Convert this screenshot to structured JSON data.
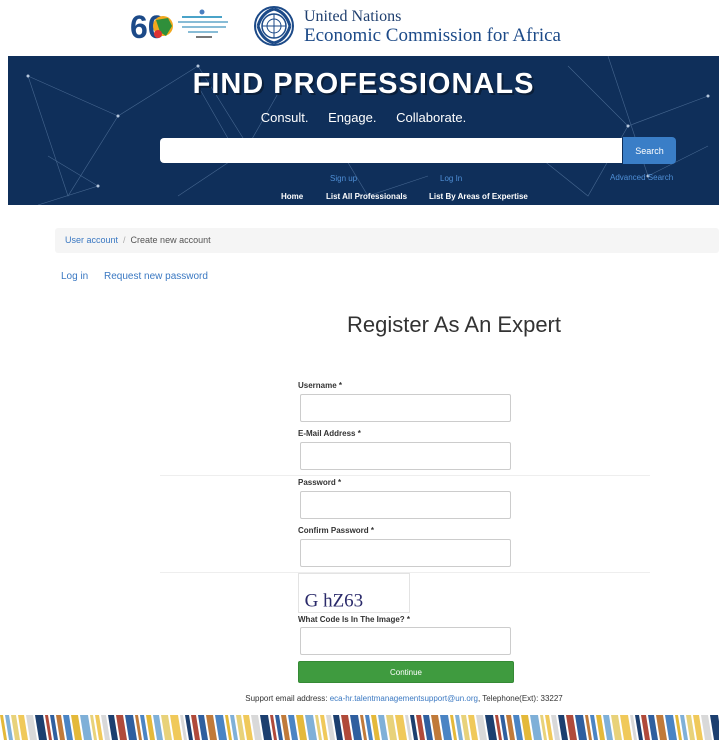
{
  "header": {
    "org_line1": "United Nations",
    "org_line2": "Economic Commission for Africa",
    "anniversary_mark": "60"
  },
  "hero": {
    "title": "FIND PROFESSIONALS",
    "subtitle": "Consult. Engage. Collaborate.",
    "search": {
      "placeholder": "",
      "value": "",
      "button_label": "Search"
    },
    "signup_label": "Sign up",
    "login_label": "Log In",
    "advanced_search_label": "Advanced Search",
    "nav": {
      "home": "Home",
      "list_all": "List All Professionals",
      "list_by_area": "List By Areas of Expertise"
    }
  },
  "breadcrumb": {
    "item1": "User account",
    "separator": "/",
    "item2": "Create new account"
  },
  "tabs": {
    "login": "Log in",
    "reset": "Request new password"
  },
  "page_title": "Register As An Expert",
  "form": {
    "username_label": "Username",
    "email_label": "E-Mail Address",
    "password_label": "Password",
    "confirm_label": "Confirm Password",
    "captcha_label": "What Code Is In The Image?",
    "required_mark": "*",
    "captcha_text": "G hZ63",
    "continue_label": "Continue"
  },
  "footer": {
    "support_prefix": "Support email address:",
    "support_email": "eca-hr.talentmanagementsupport@un.org",
    "support_suffix": ", Telephone(Ext): 33227"
  },
  "colors": {
    "hero_bg": "#0f2f5a",
    "link": "#3a78c2",
    "search_button": "#3a7ec7",
    "continue_button": "#3f9b3f"
  }
}
